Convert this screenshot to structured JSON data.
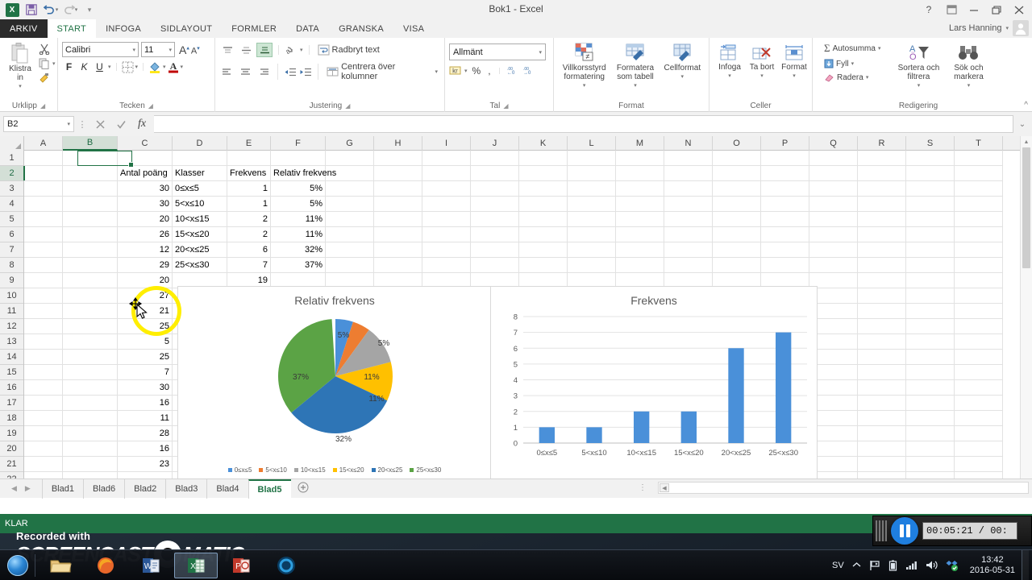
{
  "window": {
    "title": "Bok1 - Excel",
    "user": "Lars Hanning",
    "help_icon": "?",
    "ribbon_display_icon": "ribbon-display",
    "minimize_icon": "–",
    "restore_icon": "restore",
    "close_icon": "✕"
  },
  "quick_access": {
    "excel_logo": "X",
    "save_label": "save-icon",
    "undo_label": "undo-icon",
    "redo_label": "redo-icon",
    "customize_label": "customize-icon"
  },
  "tabs": [
    {
      "label": "ARKIV",
      "active": false,
      "file": true
    },
    {
      "label": "START",
      "active": true,
      "file": false
    },
    {
      "label": "INFOGA",
      "active": false,
      "file": false
    },
    {
      "label": "SIDLAYOUT",
      "active": false,
      "file": false
    },
    {
      "label": "FORMLER",
      "active": false,
      "file": false
    },
    {
      "label": "DATA",
      "active": false,
      "file": false
    },
    {
      "label": "GRANSKA",
      "active": false,
      "file": false
    },
    {
      "label": "VISA",
      "active": false,
      "file": false
    }
  ],
  "ribbon": {
    "groups": [
      {
        "name": "Urklipp"
      },
      {
        "name": "Tecken"
      },
      {
        "name": "Justering"
      },
      {
        "name": "Tal"
      },
      {
        "name": "Format"
      },
      {
        "name": "Celler"
      },
      {
        "name": "Redigering"
      }
    ],
    "clipboard": {
      "paste_label": "Klistra in",
      "cut_label": "cut-icon",
      "copy_label": "copy-icon",
      "format_painter_label": "format-painter-icon"
    },
    "font": {
      "font_name": "Calibri",
      "font_size": "11",
      "grow_font": "A",
      "shrink_font": "A",
      "bold": "F",
      "italic": "K",
      "underline": "U",
      "borders": "borders-icon",
      "fill_color": "fill-color-icon",
      "font_color": "A"
    },
    "alignment": {
      "wrap_text": "Radbryt text",
      "merge_center": "Centrera över kolumner",
      "orientation": "orientation-icon"
    },
    "number": {
      "format": "Allmänt",
      "accounting": "accounting-icon",
      "percent": "%",
      "thousands": ",",
      "increase_dec": "increase-decimal-icon",
      "decrease_dec": "decrease-decimal-icon"
    },
    "styles": {
      "conditional": "Villkorsstyrd formatering",
      "table": "Formatera som tabell",
      "cellstyle": "Cellformat"
    },
    "cells": {
      "insert": "Infoga",
      "delete": "Ta bort",
      "format": "Format"
    },
    "editing": {
      "autosum": "Autosumma",
      "fill": "Fyll",
      "clear": "Radera",
      "sort_filter": "Sortera och filtrera",
      "find_select": "Sök och markera"
    },
    "collapse_icon": "^"
  },
  "formula_bar": {
    "name_box": "B2",
    "cancel_icon": "✕",
    "enter_icon": "✓",
    "fx_icon": "fx",
    "value": "",
    "expand_icon": "⌄"
  },
  "grid": {
    "columns": [
      "A",
      "B",
      "C",
      "D",
      "E",
      "F",
      "G",
      "H",
      "I",
      "J",
      "K",
      "L",
      "M",
      "N",
      "O",
      "P",
      "Q",
      "R",
      "S",
      "T"
    ],
    "selected_column": "B",
    "selected_row": 2,
    "rows": [
      {
        "n": 1,
        "C": "",
        "D": "",
        "E": "",
        "F": ""
      },
      {
        "n": 2,
        "C": "Antal poäng",
        "D": "Klasser",
        "E": "Frekvens",
        "F": "Relativ frekvens"
      },
      {
        "n": 3,
        "C": "30",
        "D": "0≤x≤5",
        "E": "1",
        "F": "5%"
      },
      {
        "n": 4,
        "C": "30",
        "D": "5<x≤10",
        "E": "1",
        "F": "5%"
      },
      {
        "n": 5,
        "C": "20",
        "D": "10<x≤15",
        "E": "2",
        "F": "11%"
      },
      {
        "n": 6,
        "C": "26",
        "D": "15<x≤20",
        "E": "2",
        "F": "11%"
      },
      {
        "n": 7,
        "C": "12",
        "D": "20<x≤25",
        "E": "6",
        "F": "32%"
      },
      {
        "n": 8,
        "C": "29",
        "D": "25<x≤30",
        "E": "7",
        "F": "37%"
      },
      {
        "n": 9,
        "C": "20",
        "D": "",
        "E": "19",
        "F": ""
      },
      {
        "n": 10,
        "C": "27",
        "D": "",
        "E": "",
        "F": ""
      },
      {
        "n": 11,
        "C": "21",
        "D": "",
        "E": "",
        "F": ""
      },
      {
        "n": 12,
        "C": "25",
        "D": "",
        "E": "",
        "F": ""
      },
      {
        "n": 13,
        "C": "5",
        "D": "",
        "E": "",
        "F": ""
      },
      {
        "n": 14,
        "C": "25",
        "D": "",
        "E": "",
        "F": ""
      },
      {
        "n": 15,
        "C": "7",
        "D": "",
        "E": "",
        "F": ""
      },
      {
        "n": 16,
        "C": "30",
        "D": "",
        "E": "",
        "F": ""
      },
      {
        "n": 17,
        "C": "16",
        "D": "",
        "E": "",
        "F": ""
      },
      {
        "n": 18,
        "C": "11",
        "D": "",
        "E": "",
        "F": ""
      },
      {
        "n": 19,
        "C": "28",
        "D": "",
        "E": "",
        "F": ""
      },
      {
        "n": 20,
        "C": "16",
        "D": "",
        "E": "",
        "F": ""
      },
      {
        "n": 21,
        "C": "23",
        "D": "",
        "E": "",
        "F": ""
      },
      {
        "n": 22,
        "C": "",
        "D": "",
        "E": "",
        "F": ""
      }
    ]
  },
  "chart_data": [
    {
      "type": "pie",
      "title": "Relativ frekvens",
      "categories": [
        "0≤x≤5",
        "5<x≤10",
        "10<x≤15",
        "15<x≤20",
        "20<x≤25",
        "25<x≤30"
      ],
      "values": [
        5,
        5,
        11,
        11,
        32,
        37
      ],
      "data_labels": [
        "5%",
        "5%",
        "11%",
        "11%",
        "32%",
        "37%"
      ],
      "colors": [
        "#4a90d9",
        "#ed7d31",
        "#a5a5a5",
        "#ffc000",
        "#2e75b6",
        "#5ba345"
      ],
      "legend_position": "bottom",
      "unit": "%"
    },
    {
      "type": "bar",
      "title": "Frekvens",
      "categories": [
        "0≤x≤5",
        "5<x≤10",
        "10<x≤15",
        "15<x≤20",
        "20<x≤25",
        "25<x≤30"
      ],
      "values": [
        1,
        1,
        2,
        2,
        6,
        7
      ],
      "ylabel": "",
      "xlabel": "",
      "ylim": [
        0,
        8
      ],
      "yticks": [
        0,
        1,
        2,
        3,
        4,
        5,
        6,
        7,
        8
      ],
      "grid": true,
      "legend_position": "none",
      "bar_color": "#4a90d9"
    }
  ],
  "sheets": {
    "nav_prev": "◀",
    "nav_next": "▶",
    "tabs": [
      {
        "label": "Blad1",
        "active": false
      },
      {
        "label": "Blad6",
        "active": false
      },
      {
        "label": "Blad2",
        "active": false
      },
      {
        "label": "Blad3",
        "active": false
      },
      {
        "label": "Blad4",
        "active": false
      },
      {
        "label": "Blad5",
        "active": true
      }
    ],
    "add_label": "+"
  },
  "status_bar": {
    "mode": "KLAR",
    "view_normal": "normal-view-icon",
    "view_pagelayout": "page-layout-icon",
    "view_pagebreak": "page-break-icon"
  },
  "recorder": {
    "watermark_top": "Recorded with",
    "watermark_brand_1": "SCREENCAST",
    "watermark_brand_2": "MATIC",
    "pause_icon": "pause-icon",
    "timecode": "00:05:21 / 00:"
  },
  "taskbar": {
    "start": "start-orb",
    "items": [
      {
        "name": "explorer",
        "active": false
      },
      {
        "name": "firefox",
        "active": false
      },
      {
        "name": "word",
        "active": false
      },
      {
        "name": "excel",
        "active": true
      },
      {
        "name": "powerpoint",
        "active": false
      },
      {
        "name": "media-player",
        "active": false
      }
    ],
    "language": "SV",
    "time": "13:42",
    "date": "2016-05-31"
  }
}
